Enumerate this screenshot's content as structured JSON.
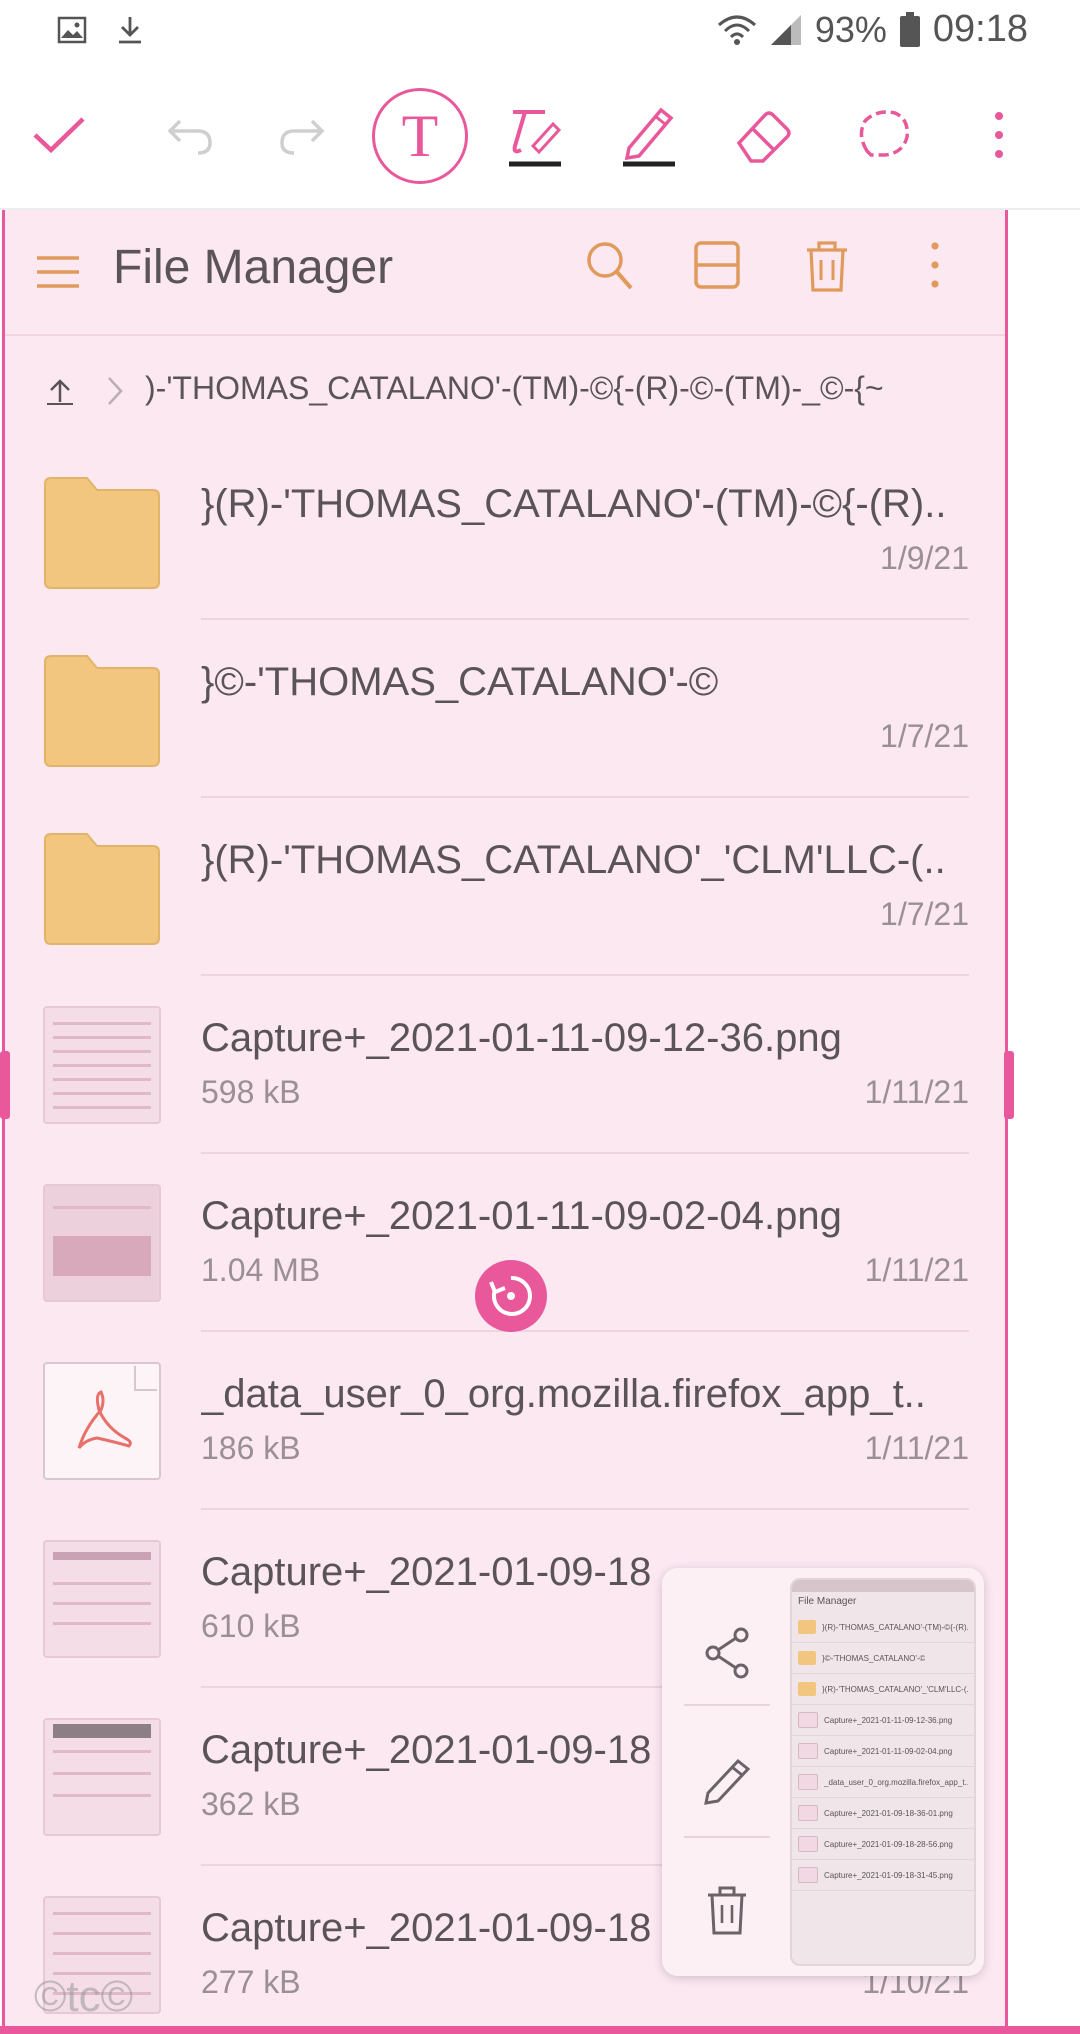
{
  "status_bar": {
    "left_icons": [
      "image-icon",
      "download-icon"
    ],
    "battery": "93%",
    "time": "09:18"
  },
  "toolbar": {
    "tools": [
      "check-icon",
      "undo-icon",
      "redo-icon",
      "text-tool-icon",
      "pen-tool-icon",
      "pencil-tool-icon",
      "eraser-icon",
      "lasso-icon",
      "more-icon"
    ],
    "text_tool_label": "T",
    "accent_color": "#e8589a"
  },
  "file_manager": {
    "title": "File Manager",
    "breadcrumb": ")-'THOMAS_CATALANO'-(TM)-©{-(R)-©-(TM)-_©-{~",
    "files": [
      {
        "name": "}(R)-'THOMAS_CATALANO'-(TM)-©{-(R)..",
        "size": "",
        "date": "1/9/21",
        "type": "folder"
      },
      {
        "name": "}©-'THOMAS_CATALANO'-©",
        "size": "",
        "date": "1/7/21",
        "type": "folder"
      },
      {
        "name": "}(R)-'THOMAS_CATALANO'_'CLM'LLC-(..",
        "size": "",
        "date": "1/7/21",
        "type": "folder"
      },
      {
        "name": "Capture+_2021-01-11-09-12-36.png",
        "size": "598 kB",
        "date": "1/11/21",
        "type": "image"
      },
      {
        "name": "Capture+_2021-01-11-09-02-04.png",
        "size": "1.04 MB",
        "date": "1/11/21",
        "type": "image"
      },
      {
        "name": "_data_user_0_org.mozilla.firefox_app_t..",
        "size": "186 kB",
        "date": "1/11/21",
        "type": "pdf"
      },
      {
        "name": "Capture+_2021-01-09-18",
        "size": "610 kB",
        "date": "",
        "type": "image"
      },
      {
        "name": "Capture+_2021-01-09-18",
        "size": "362 kB",
        "date": "",
        "type": "image"
      },
      {
        "name": "Capture+_2021-01-09-18",
        "size": "277 kB",
        "date": "1/10/21",
        "type": "image"
      }
    ]
  },
  "preview_panel": {
    "actions": [
      "share-icon",
      "edit-icon",
      "delete-icon"
    ],
    "thumb_title": "File Manager",
    "thumb_rows": [
      "}(R)-'THOMAS_CATALANO'-(TM)-©{-(R)..",
      "}©-'THOMAS_CATALANO'-©",
      "}(R)-'THOMAS_CATALANO'_'CLM'LLC-(..",
      "Capture+_2021-01-11-09-12-36.png",
      "Capture+_2021-01-11-09-02-04.png",
      "_data_user_0_org.mozilla.firefox_app_t..",
      "Capture+_2021-01-09-18-36-01.png",
      "Capture+_2021-01-09-18-28-56.png",
      "Capture+_2021-01-09-18-31-45.png"
    ]
  },
  "watermark": "©tc©"
}
